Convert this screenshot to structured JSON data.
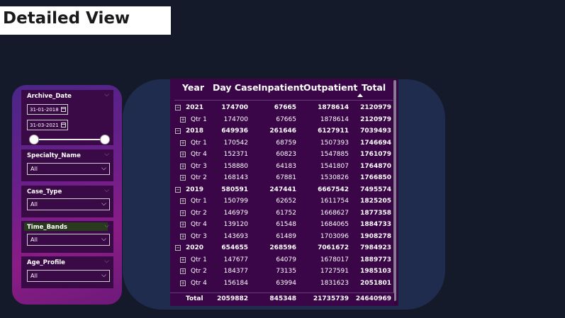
{
  "page": {
    "title": "Detailed View"
  },
  "filters": {
    "archive_date": {
      "label": "Archive_Date",
      "start": "31-01-2018",
      "end": "31-03-2021",
      "slider_start_fraction": 0.0,
      "slider_end_fraction": 1.0
    },
    "specialty_name": {
      "label": "Specialty_Name",
      "value": "All"
    },
    "case_type": {
      "label": "Case_Type",
      "value": "All"
    },
    "time_bands": {
      "label": "Time_Bands",
      "value": "All"
    },
    "age_profile": {
      "label": "Age_Profile",
      "value": "All"
    }
  },
  "table": {
    "columns": [
      "Year",
      "Day Case",
      "Inpatient",
      "Outpatient",
      "Total"
    ],
    "sort_column": "Total",
    "rows": [
      {
        "type": "year",
        "label": "2021",
        "values": [
          "174700",
          "67665",
          "1878614",
          "2120979"
        ]
      },
      {
        "type": "qtr",
        "label": "Qtr 1",
        "values": [
          "174700",
          "67665",
          "1878614",
          "2120979"
        ]
      },
      {
        "type": "year",
        "label": "2018",
        "values": [
          "649936",
          "261646",
          "6127911",
          "7039493"
        ]
      },
      {
        "type": "qtr",
        "label": "Qtr 1",
        "values": [
          "170542",
          "68759",
          "1507393",
          "1746694"
        ]
      },
      {
        "type": "qtr",
        "label": "Qtr 4",
        "values": [
          "152371",
          "60823",
          "1547885",
          "1761079"
        ]
      },
      {
        "type": "qtr",
        "label": "Qtr 3",
        "values": [
          "158880",
          "64183",
          "1541807",
          "1764870"
        ]
      },
      {
        "type": "qtr",
        "label": "Qtr 2",
        "values": [
          "168143",
          "67881",
          "1530826",
          "1766850"
        ]
      },
      {
        "type": "year",
        "label": "2019",
        "values": [
          "580591",
          "247441",
          "6667542",
          "7495574"
        ]
      },
      {
        "type": "qtr",
        "label": "Qtr 1",
        "values": [
          "150799",
          "62652",
          "1611754",
          "1825205"
        ]
      },
      {
        "type": "qtr",
        "label": "Qtr 2",
        "values": [
          "146979",
          "61752",
          "1668627",
          "1877358"
        ]
      },
      {
        "type": "qtr",
        "label": "Qtr 4",
        "values": [
          "139120",
          "61548",
          "1684065",
          "1884733"
        ]
      },
      {
        "type": "qtr",
        "label": "Qtr 3",
        "values": [
          "143693",
          "61489",
          "1703096",
          "1908278"
        ]
      },
      {
        "type": "year",
        "label": "2020",
        "values": [
          "654655",
          "268596",
          "7061672",
          "7984923"
        ]
      },
      {
        "type": "qtr",
        "label": "Qtr 1",
        "values": [
          "147677",
          "64079",
          "1678017",
          "1889773"
        ]
      },
      {
        "type": "qtr",
        "label": "Qtr 2",
        "values": [
          "184377",
          "73135",
          "1727591",
          "1985103"
        ]
      },
      {
        "type": "qtr",
        "label": "Qtr 4",
        "values": [
          "156184",
          "63994",
          "1831623",
          "2051801"
        ]
      }
    ],
    "total": {
      "label": "Total",
      "values": [
        "2059882",
        "845348",
        "21735739",
        "24640969"
      ]
    }
  },
  "icons": {
    "expand": "expand-plus-icon",
    "collapse": "collapse-minus-icon",
    "calendar": "calendar-icon",
    "chevron": "chevron-down-icon",
    "sort": "sort-up-icon"
  }
}
